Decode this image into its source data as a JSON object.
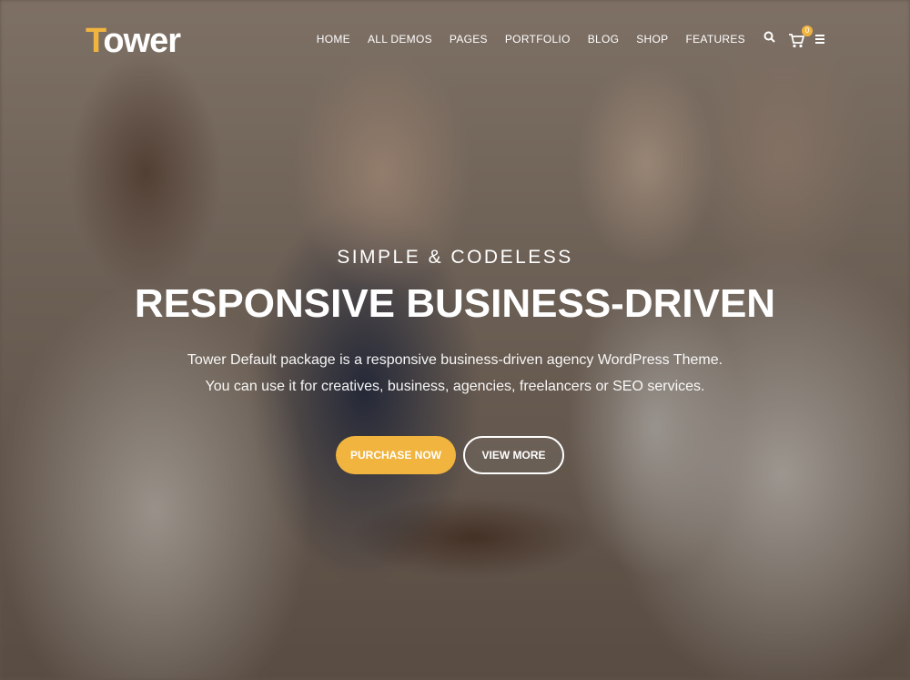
{
  "header": {
    "logo_first": "T",
    "logo_rest": "ower",
    "nav": [
      "HOME",
      "ALL DEMOS",
      "PAGES",
      "PORTFOLIO",
      "BLOG",
      "SHOP",
      "FEATURES"
    ],
    "cart_count": "0",
    "icons": [
      "search-icon",
      "cart-icon",
      "menu-icon"
    ]
  },
  "hero": {
    "subtitle": "SIMPLE & CODELESS",
    "headline": "RESPONSIVE BUSINESS-DRIVEN",
    "desc_line1": "Tower Default package is a responsive business-driven agency WordPress Theme.",
    "desc_line2": "You can use it for creatives, business, agencies, freelancers or SEO services.",
    "primary_button": "PURCHASE NOW",
    "secondary_button": "VIEW MORE"
  },
  "colors": {
    "accent": "#f0b43f",
    "text": "#ffffff"
  }
}
